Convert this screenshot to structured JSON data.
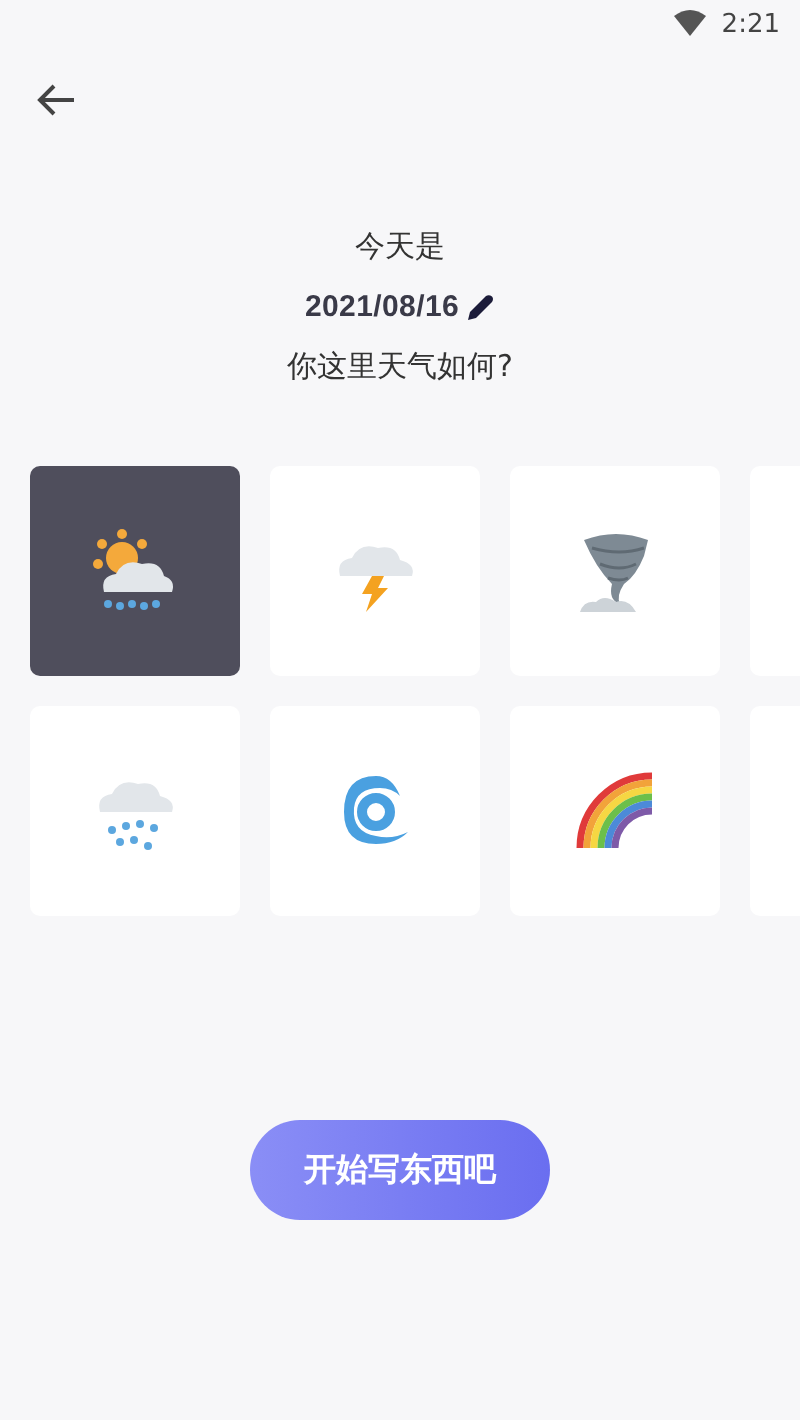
{
  "status_bar": {
    "time": "2:21"
  },
  "header": {
    "intro": "今天是",
    "date": "2021/08/16",
    "question": "你这里天气如何?"
  },
  "weather_tiles": [
    {
      "kind": "sun-rain",
      "selected": true
    },
    {
      "kind": "thunder",
      "selected": false
    },
    {
      "kind": "tornado",
      "selected": false
    },
    {
      "kind": "offscreen",
      "selected": false
    },
    {
      "kind": "rain",
      "selected": false
    },
    {
      "kind": "cyclone",
      "selected": false
    },
    {
      "kind": "rainbow",
      "selected": false
    },
    {
      "kind": "offscreen",
      "selected": false
    }
  ],
  "start_button": {
    "label": "开始写东西吧"
  }
}
